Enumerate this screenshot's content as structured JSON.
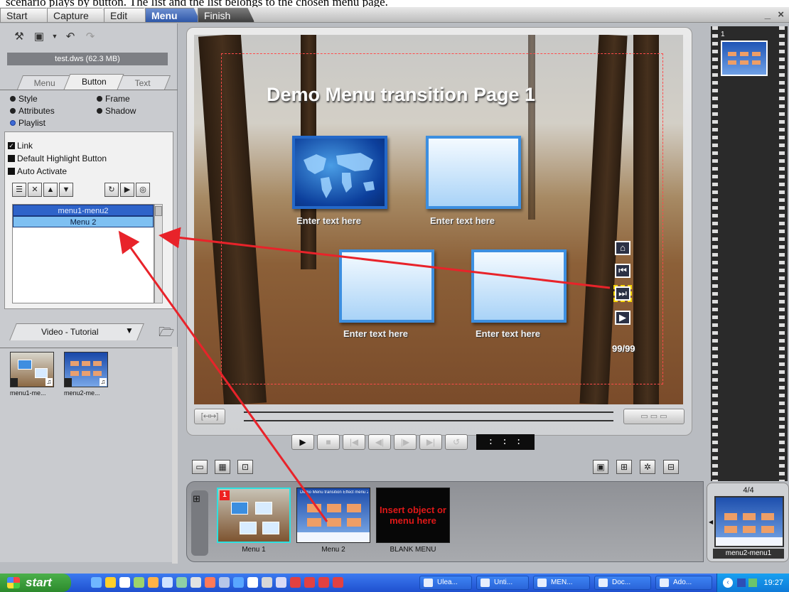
{
  "caption": "scenario plays by button. The list and the list belongs to the chosen menu page.",
  "appbar": {
    "tabs": [
      "Start",
      "Capture",
      "Edit",
      "Menu",
      "Finish"
    ],
    "active_tab": "Menu",
    "window_controls": "_ ×"
  },
  "left": {
    "file_info": "test.dws (62.3 MB)",
    "subtabs": [
      "Menu",
      "Button",
      "Text"
    ],
    "active_subtab": "Button",
    "options": {
      "style": "Style",
      "frame": "Frame",
      "attributes": "Attributes",
      "shadow": "Shadow",
      "playlist": "Playlist",
      "selected": "Playlist"
    },
    "checkboxes": {
      "link": "Link",
      "default_highlight": "Default Highlight Button",
      "auto_activate": "Auto Activate",
      "link_checked": true
    },
    "link_list": [
      "menu1-menu2",
      "Menu 2"
    ],
    "library_tab": "Video - Tutorial",
    "library_items": [
      "menu1-me...",
      "menu2-me..."
    ]
  },
  "preview": {
    "menu_title": "Demo Menu transition Page 1",
    "button_labels": [
      "Enter text here",
      "Enter text here",
      "Enter text here",
      "Enter text here"
    ],
    "page_number": "99/99"
  },
  "transport": {
    "timecode": ": : :"
  },
  "filmstrip": {
    "items": [
      {
        "caption": "Menu 1",
        "badge": "1"
      },
      {
        "caption": "Menu 2",
        "title": "Demo Menu transition Effect menu 2"
      },
      {
        "caption": "BLANK MENU",
        "placeholder": "Insert object or menu here"
      }
    ]
  },
  "right_panel": {
    "frame_number": "1",
    "page_count": "4/4",
    "preview_caption": "menu2-menu1"
  },
  "taskbar": {
    "start": "start",
    "items": [
      "Ulea...",
      "Unti...",
      "MEN...",
      "Doc...",
      "Ado..."
    ],
    "clock": "19:27"
  },
  "colors": {
    "accent": "#2e57a8",
    "selection": "#2e63c9",
    "annotation_arrow": "#e8232a",
    "safe_area": "#ff4a4a"
  }
}
